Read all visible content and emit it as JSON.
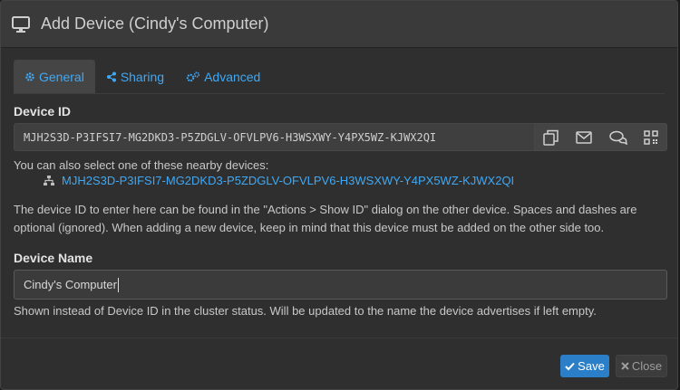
{
  "dialog": {
    "title": "Add Device (Cindy's Computer)",
    "icon": "desktop-icon"
  },
  "tabs": [
    {
      "label": "General",
      "icon": "gear-icon",
      "active": true
    },
    {
      "label": "Sharing",
      "icon": "share-icon",
      "active": false
    },
    {
      "label": "Advanced",
      "icon": "gears-icon",
      "active": false
    }
  ],
  "device_id": {
    "label": "Device ID",
    "value": "MJH2S3D-P3IFSI7-MG2DKD3-P5ZDGLV-OFVLPV6-H3WSXWY-Y4PX5WZ-KJWX2QI",
    "action_icons": [
      "copy-icon",
      "email-icon",
      "chat-icon",
      "qrcode-icon"
    ]
  },
  "nearby": {
    "intro": "You can also select one of these nearby devices:",
    "devices": [
      "MJH2S3D-P3IFSI7-MG2DKD3-P5ZDGLV-OFVLPV6-H3WSXWY-Y4PX5WZ-KJWX2QI"
    ]
  },
  "help": {
    "device_id": "The device ID to enter here can be found in the \"Actions > Show ID\" dialog on the other device. Spaces and dashes are optional (ignored). When adding a new device, keep in mind that this device must be added on the other side too.",
    "device_name": "Shown instead of Device ID in the cluster status. Will be updated to the name the device advertises if left empty."
  },
  "device_name": {
    "label": "Device Name",
    "value": "Cindy's Computer"
  },
  "footer": {
    "save_label": "Save",
    "close_label": "Close"
  },
  "colors": {
    "accent": "#3fa9f5",
    "save_button": "#2a7fc8",
    "background": "#2f2f2f"
  }
}
